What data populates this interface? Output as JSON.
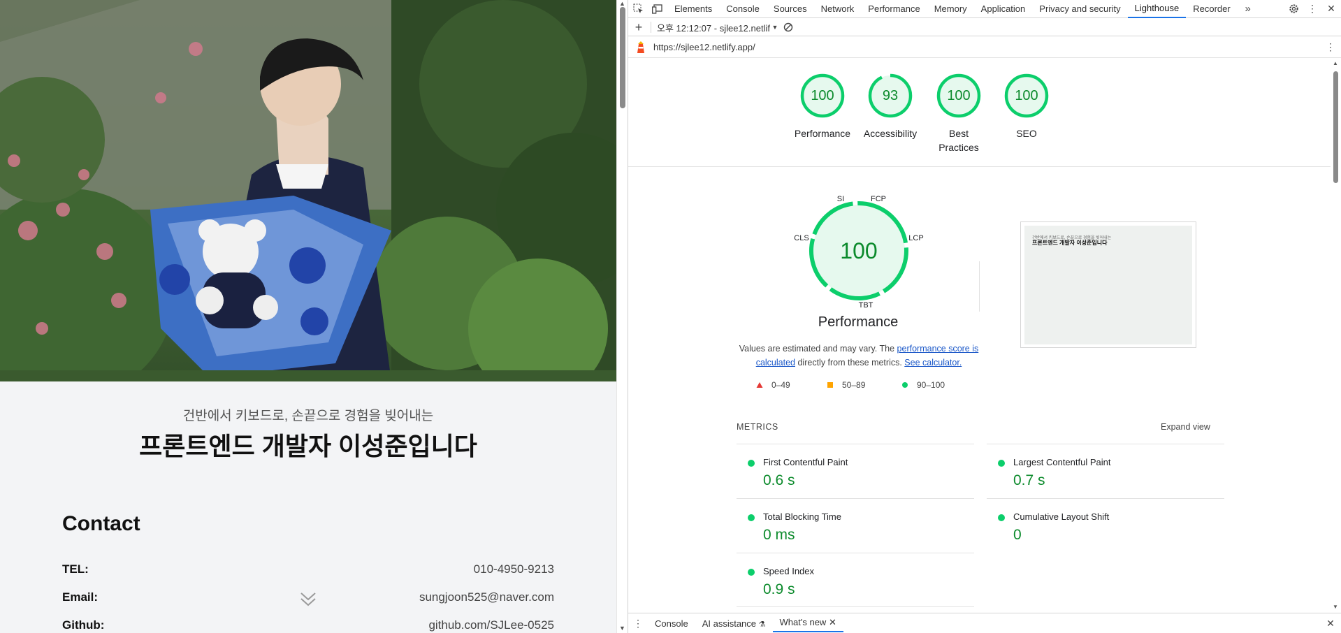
{
  "website": {
    "hero_subtitle": "건반에서 키보드로, 손끝으로 경험을 빚어내는",
    "hero_title": "프론트엔드 개발자 이성준입니다",
    "contact_heading": "Contact",
    "contacts": [
      {
        "label": "TEL:",
        "value": "010-4950-9213"
      },
      {
        "label": "Email:",
        "value": "sungjoon525@naver.com"
      },
      {
        "label": "Github:",
        "value": "github.com/SJLee-0525"
      }
    ]
  },
  "devtools": {
    "tabs": [
      "Elements",
      "Console",
      "Sources",
      "Network",
      "Performance",
      "Memory",
      "Application",
      "Privacy and security",
      "Lighthouse",
      "Recorder"
    ],
    "active_tab": "Lighthouse",
    "more_tabs_icon": "chevron-double-right-icon",
    "report_selector": "오후 12:12:07 - sjlee12.netlif",
    "url": "https://sjlee12.netlify.app/",
    "category_scores": [
      {
        "label": "Performance",
        "score": "100",
        "value": 100
      },
      {
        "label": "Accessibility",
        "score": "93",
        "value": 93
      },
      {
        "label": "Best Practices",
        "score": "100",
        "value": 100
      },
      {
        "label": "SEO",
        "score": "100",
        "value": 100
      }
    ],
    "perf_gauge": {
      "score": "100",
      "title": "Performance",
      "labels": {
        "si": "SI",
        "fcp": "FCP",
        "lcp": "LCP",
        "tbt": "TBT",
        "cls": "CLS"
      }
    },
    "note": {
      "text1": "Values are estimated and may vary. The ",
      "link1": "performance score is calculated",
      "text2": " directly from these metrics. ",
      "link2": "See calculator."
    },
    "legend": [
      {
        "range": "0–49",
        "color": "#e53935",
        "shape": "triangle"
      },
      {
        "range": "50–89",
        "color": "#ffa400",
        "shape": "square"
      },
      {
        "range": "90–100",
        "color": "#0cce6b",
        "shape": "circle"
      }
    ],
    "metrics_heading": "METRICS",
    "expand_view": "Expand view",
    "metrics": [
      {
        "name": "First Contentful Paint",
        "value": "0.6 s"
      },
      {
        "name": "Largest Contentful Paint",
        "value": "0.7 s"
      },
      {
        "name": "Total Blocking Time",
        "value": "0 ms"
      },
      {
        "name": "Cumulative Layout Shift",
        "value": "0"
      },
      {
        "name": "Speed Index",
        "value": "0.9 s"
      }
    ],
    "screenshot_thumb": {
      "line1": "건반에서 키보드로, 손끝으로 경험을 빚어내는",
      "line2": "프론트엔드 개발자 이성준입니다"
    },
    "drawer_tabs": [
      "Console",
      "AI assistance",
      "What's new"
    ],
    "drawer_active": "What's new",
    "colors": {
      "pass": "#0cce6b",
      "pass_text": "#0b8a2b",
      "accent": "#1a73e8"
    }
  }
}
